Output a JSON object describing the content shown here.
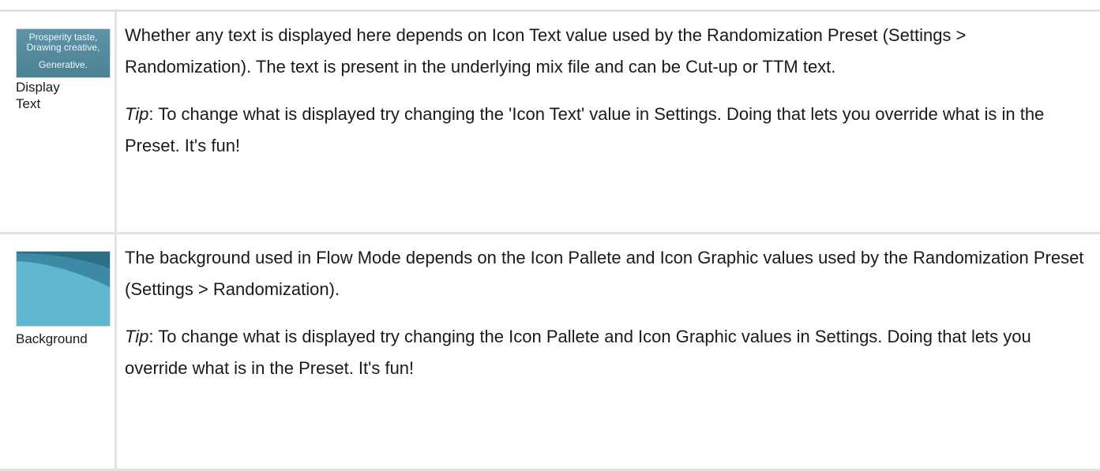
{
  "rows": [
    {
      "thumbnail": {
        "lines": [
          "Prosperity taste,",
          "Drawing creative,",
          "Generative."
        ],
        "colors": {
          "bg_top": "#5f93a7",
          "bg_bottom": "#4c8296",
          "text": "#eef6f8"
        }
      },
      "caption_line1": "Display",
      "caption_line2": "Text",
      "description": "Whether any text is displayed here depends on Icon Text value used by the Randomization Preset (Settings > Randomization). The text is present in the underlying mix file and can be Cut-up or TTM text.",
      "tip_label": "Tip",
      "tip_text": ": To change what is displayed try changing the 'Icon Text' value in Settings. Doing that lets you override what is in the Preset. It's fun!"
    },
    {
      "thumbnail": {
        "colors": {
          "base": "#5fb8cf",
          "arc_outer": "#3d8aa4",
          "arc_inner": "#2e6f88"
        }
      },
      "caption": "Background",
      "description": "The background used in Flow Mode depends on the Icon Pallete and Icon Graphic values used by the Randomization Preset (Settings > Randomization).",
      "tip_label": "Tip",
      "tip_text": ": To change what is displayed try changing the Icon Pallete and Icon Graphic values in Settings. Doing that lets you override what is in the Preset. It's fun!"
    }
  ]
}
